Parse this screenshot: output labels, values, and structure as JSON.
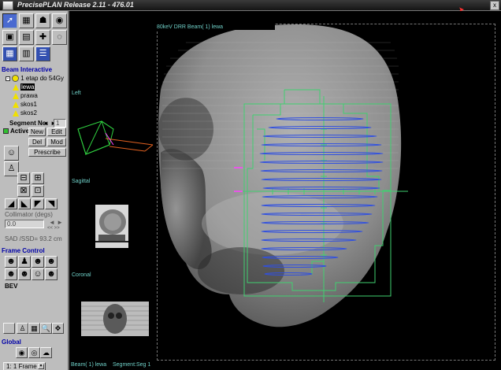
{
  "window": {
    "title": "PrecisePLAN Release 2.11  -  476.01",
    "close_glyph": "x"
  },
  "toolbar": {
    "icons": [
      "select-arrow-icon",
      "dose-icon",
      "patient-icon",
      "eye-icon",
      "grid-view-icon",
      "layers-icon",
      "beam-setup-icon",
      "table-icon",
      "list-icon"
    ]
  },
  "beam_interactive": {
    "header": "Beam Interactive",
    "tree": {
      "root_toggle": "-",
      "root": "1 etap do 54Gy",
      "beams": [
        "lewa",
        "prawa",
        "skos1",
        "skos2"
      ],
      "selected_beam": "lewa"
    },
    "segment_label": "Segment No.",
    "segment_arrows": "◄ ►",
    "segment_value": "1",
    "active_label": "Active",
    "buttons": {
      "new": "New",
      "edit": "Edit",
      "del": "Del",
      "mod": "Mod",
      "prescribe": "Prescribe"
    },
    "collimator_label": "Collimator (degs)",
    "collimator_value": "0.0",
    "collimator_arrows": "◄ ►",
    "collimator_fine": "<< >>",
    "sad_text": "SAD /SSD= 93.2 cm"
  },
  "frame_control": {
    "header": "Frame Control",
    "bev_label": "BEV"
  },
  "global": {
    "header": "Global",
    "frame_select": "1: 1 Frame"
  },
  "views": {
    "left": "Left",
    "sagittal": "Sagittal",
    "coronal": "Coronal",
    "drr_label": "80keV DRR Beam( 1) lewa",
    "beam_footer": "Beam( 1) lewa",
    "segment_footer": "Segment:Seg 1"
  },
  "colors": {
    "panel_bg": "#bdbdbd",
    "section_title": "#0000a8",
    "field_outline": "#40d070",
    "mlc_contour": "#3050e0",
    "overlay_text": "#6fd0c8"
  }
}
